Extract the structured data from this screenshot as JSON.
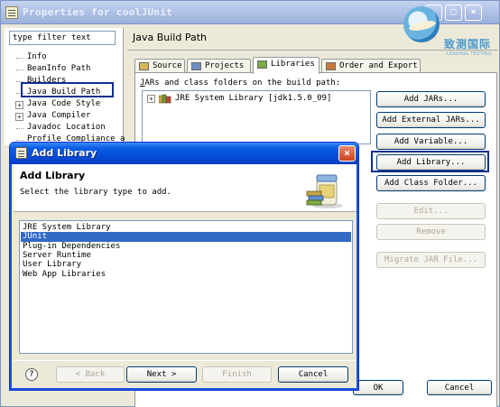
{
  "props_window": {
    "title": "Properties for coolJUnit",
    "controls": {
      "minimize": "_",
      "maximize": "□",
      "close": "×"
    },
    "filter_input": {
      "value": "type filter text"
    },
    "tree": {
      "items": [
        {
          "label": "Info",
          "expander": ""
        },
        {
          "label": "BeanInfo Path",
          "expander": ""
        },
        {
          "label": "Builders",
          "expander": ""
        },
        {
          "label": "Java Build Path",
          "expander": "",
          "selected": true
        },
        {
          "label": "Java Code Style",
          "expander": "+"
        },
        {
          "label": "Java Compiler",
          "expander": "+"
        },
        {
          "label": "Javadoc Location",
          "expander": ""
        },
        {
          "label": "Profile Compliance a",
          "expander": ""
        }
      ]
    },
    "page_title": "Java Build Path",
    "tabs": [
      {
        "label": "Source",
        "icon": "source-folder-icon"
      },
      {
        "label": "Projects",
        "icon": "projects-icon"
      },
      {
        "label": "Libraries",
        "icon": "libraries-icon",
        "active": true
      },
      {
        "label": "Order and Export",
        "icon": "order-export-icon"
      }
    ],
    "jars_label": "JARs and class folders on the build path:",
    "jar_entry": {
      "label": "JRE System Library [jdk1.5.0_09]",
      "expander": "+"
    },
    "buttons": {
      "add_jars": "Add JARs...",
      "add_external_jars": "Add External JARs...",
      "add_variable": "Add Variable...",
      "add_library": "Add Library...",
      "add_class_folder": "Add Class Folder...",
      "edit": "Edit...",
      "remove": "Remove",
      "migrate": "Migrate JAR File..."
    },
    "ok": "OK",
    "cancel": "Cancel"
  },
  "watermark": {
    "cn": "致测国际",
    "en": "LEADING TESTING"
  },
  "dialog": {
    "title": "Add Library",
    "close_glyph": "×",
    "heading": "Add Library",
    "description": "Select the library type to add.",
    "libraries": [
      {
        "label": "JRE System Library",
        "selected": false
      },
      {
        "label": "JUnit",
        "selected": true
      },
      {
        "label": "Plug-in Dependencies",
        "selected": false
      },
      {
        "label": "Server Runtime",
        "selected": false
      },
      {
        "label": "User Library",
        "selected": false
      },
      {
        "label": "Web App Libraries",
        "selected": false
      }
    ],
    "help_glyph": "?",
    "back": "< Back",
    "next": "Next >",
    "finish": "Finish",
    "cancel": "Cancel"
  },
  "colors": {
    "selection": "#316AC5",
    "dialog_title_blue": "#0549D6",
    "highlight_box": "#0E2F92",
    "window_bg": "#ECE9D8"
  }
}
